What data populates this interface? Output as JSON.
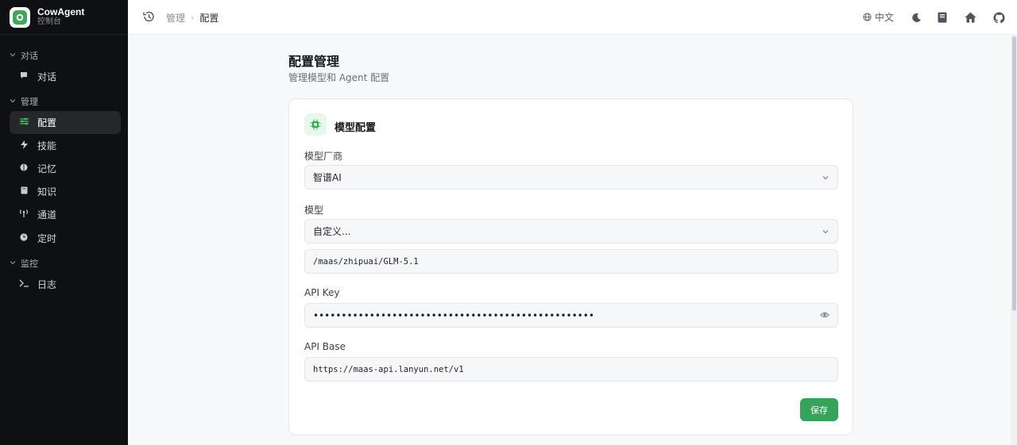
{
  "app": {
    "title": "CowAgent",
    "subtitle": "控制台"
  },
  "sidebar": {
    "groups": [
      {
        "label": "对话",
        "items": [
          {
            "label": "对话",
            "icon": "chat-icon"
          }
        ]
      },
      {
        "label": "管理",
        "items": [
          {
            "label": "配置",
            "icon": "sliders-icon",
            "active": true
          },
          {
            "label": "技能",
            "icon": "bolt-icon"
          },
          {
            "label": "记忆",
            "icon": "brain-icon"
          },
          {
            "label": "知识",
            "icon": "book-icon"
          },
          {
            "label": "通道",
            "icon": "antenna-icon"
          },
          {
            "label": "定时",
            "icon": "clock-icon"
          }
        ]
      },
      {
        "label": "监控",
        "items": [
          {
            "label": "日志",
            "icon": "terminal-icon"
          }
        ]
      }
    ]
  },
  "topbar": {
    "breadcrumb": [
      "管理",
      "配置"
    ],
    "language": "中文"
  },
  "page": {
    "title": "配置管理",
    "subtitle": "管理模型和 Agent 配置"
  },
  "card": {
    "title": "模型配置",
    "provider": {
      "label": "模型厂商",
      "value": "智谱AI"
    },
    "model": {
      "label": "模型",
      "value": "自定义...",
      "custom_value": "/maas/zhipuai/GLM-5.1"
    },
    "api_key": {
      "label": "API Key",
      "value": "••••••••••••••••••••••••••••••••••••••••••••••••••"
    },
    "api_base": {
      "label": "API Base",
      "value": "https://maas-api.lanyun.net/v1"
    },
    "save_label": "保存"
  },
  "colors": {
    "accent": "#37a35a",
    "sidebar_bg": "#0f1012",
    "active_item_bg": "#25272b"
  }
}
